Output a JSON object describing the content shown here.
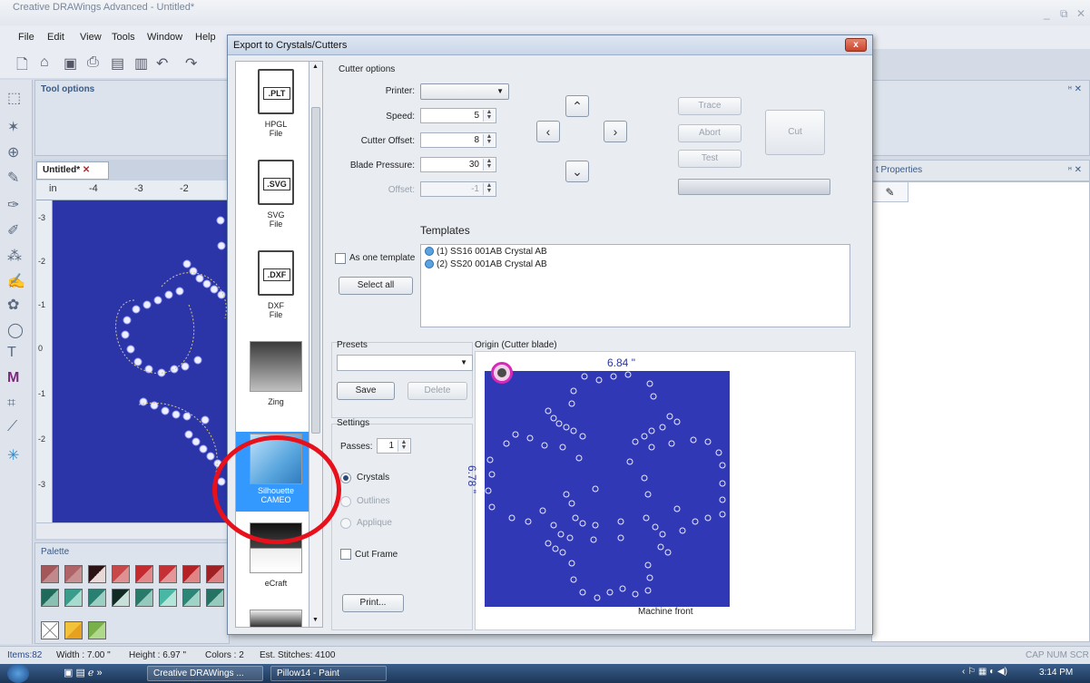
{
  "app": {
    "title": "Creative DRAWings Advanced - Untitled*",
    "menu": [
      "File",
      "Edit",
      "View",
      "Tools",
      "Window",
      "Help"
    ],
    "tool_options_title": "Tool options",
    "doc_tab": "Untitled*",
    "ruler_unit": "in",
    "ruler_ticks": [
      "-4",
      "-3",
      "-2"
    ],
    "vruler_ticks": [
      "-3",
      "-2",
      "-1",
      "0",
      "-1",
      "-2",
      "-3"
    ],
    "palette_title": "Palette",
    "right_panel_title": "t Properties",
    "window_controls": [
      "_",
      "⧉",
      "×"
    ],
    "pin": "ᵸ ×"
  },
  "status": {
    "items": "Items:82",
    "width": "Width : 7.00 \"",
    "height": "Height : 6.97 \"",
    "colors": "Colors : 2",
    "stitches": "Est. Stitches: 4100",
    "right": "CAP NUM SCR"
  },
  "taskbar": {
    "task1": "Creative DRAWings ...",
    "task2": "Pillow14 - Paint",
    "clock": "3:14 PM"
  },
  "dialog": {
    "title": "Export to Crystals/Cutters",
    "close": "x",
    "devices": [
      {
        "label": "HPGL\nFile",
        "badge": ".PLT"
      },
      {
        "label": "SVG\nFile",
        "badge": ".SVG"
      },
      {
        "label": "DXF\nFile",
        "badge": ".DXF"
      },
      {
        "label": "Zing"
      },
      {
        "label": "Silhouette\nCAMEO"
      },
      {
        "label": "eCraft"
      }
    ],
    "cutter_options": "Cutter options",
    "printer_label": "Printer:",
    "printer_value": "",
    "speed_label": "Speed:",
    "speed_value": "5",
    "cutter_offset_label": "Cutter Offset:",
    "cutter_offset_value": "8",
    "blade_pressure_label": "Blade Pressure:",
    "blade_pressure_value": "30",
    "offset_label": "Offset:",
    "offset_value": "-1",
    "trace": "Trace",
    "abort": "Abort",
    "test": "Test",
    "cut": "Cut",
    "templates_title": "Templates",
    "as_one_template": "As one template",
    "select_all": "Select all",
    "templates": [
      "(1) SS16 001AB Crystal AB",
      "(2) SS20 001AB Crystal AB"
    ],
    "presets_title": "Presets",
    "save": "Save",
    "delete": "Delete",
    "settings_title": "Settings",
    "passes_label": "Passes:",
    "passes_value": "1",
    "crystals": "Crystals",
    "outlines": "Outlines",
    "applique": "Applique",
    "cut_frame": "Cut Frame",
    "print": "Print...",
    "origin_title": "Origin (Cutter blade)",
    "width_measure": "6.84 \"",
    "height_measure": "6.78 \"",
    "machine_front": "Machine front"
  },
  "colors": {
    "canvas": "#2b35a8",
    "origin_canvas": "#3138b6",
    "highlight_circle": "#e8101b",
    "selected_device": "#3399ff"
  }
}
